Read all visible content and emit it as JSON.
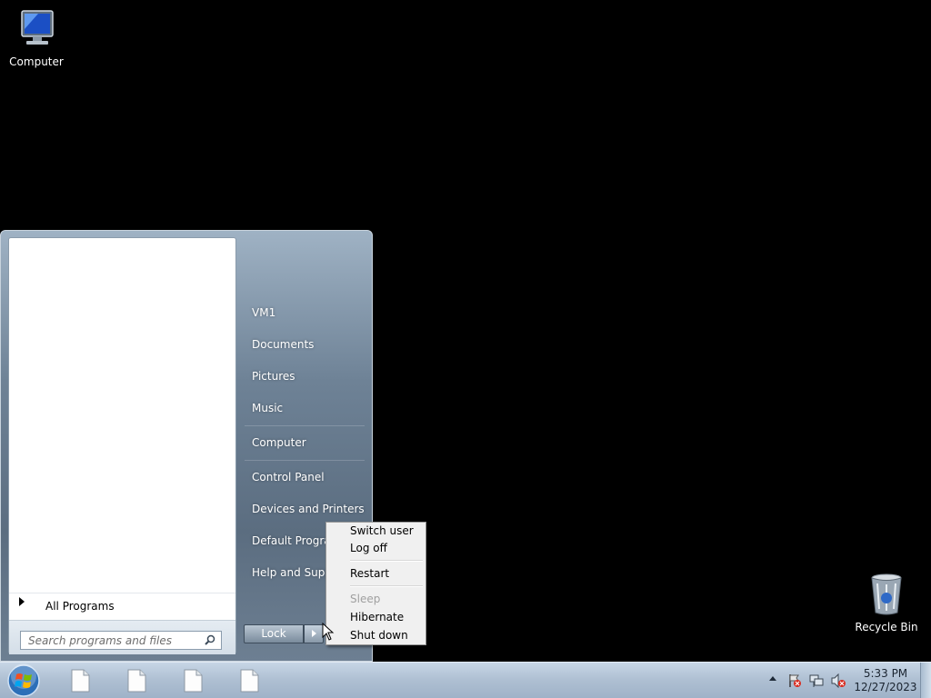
{
  "desktop": {
    "icons": [
      {
        "label": "Computer",
        "icon": "computer-icon"
      },
      {
        "label": "Recycle Bin",
        "icon": "recycle-bin-icon"
      }
    ]
  },
  "start_menu": {
    "all_programs_label": "All Programs",
    "search_placeholder": "Search programs and files",
    "right_pane": [
      {
        "label": "VM1"
      },
      {
        "label": "Documents"
      },
      {
        "label": "Pictures"
      },
      {
        "label": "Music"
      },
      {
        "label": "Computer"
      },
      {
        "label": "Control Panel"
      },
      {
        "label": "Devices and Printers"
      },
      {
        "label": "Default Programs"
      },
      {
        "label": "Help and Support"
      }
    ],
    "lock_label": "Lock"
  },
  "shutdown_menu": {
    "items": [
      {
        "label": "Switch user",
        "enabled": true
      },
      {
        "label": "Log off",
        "enabled": true
      },
      {
        "label": "Restart",
        "enabled": true
      },
      {
        "label": "Sleep",
        "enabled": false
      },
      {
        "label": "Hibernate",
        "enabled": true
      },
      {
        "label": "Shut down",
        "enabled": true
      }
    ]
  },
  "taskbar": {
    "pinned": [
      "file-icon",
      "file-icon",
      "file-icon",
      "file-icon"
    ],
    "tray_icons": [
      "action-center-flag-icon",
      "network-icon",
      "volume-muted-icon"
    ],
    "time": "5:33 PM",
    "date": "12/27/2023"
  },
  "colors": {
    "desktop_bg": "#000000",
    "start_menu_bg": "#6e8296",
    "taskbar_bg": "#b0c2d6"
  }
}
